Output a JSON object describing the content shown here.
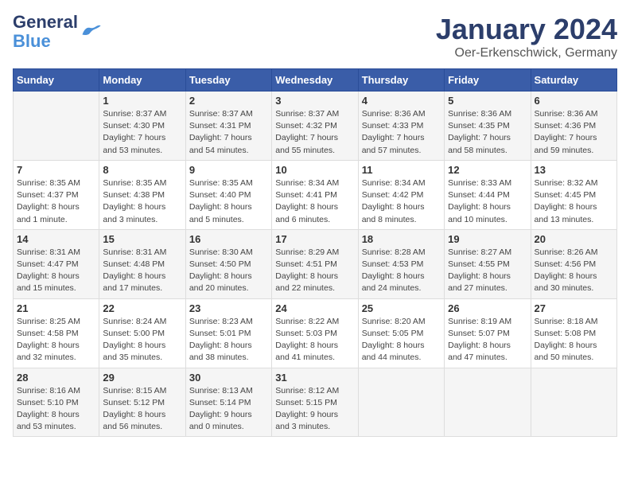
{
  "logo": {
    "line1": "General",
    "line2": "Blue"
  },
  "title": "January 2024",
  "subtitle": "Oer-Erkenschwick, Germany",
  "days_of_week": [
    "Sunday",
    "Monday",
    "Tuesday",
    "Wednesday",
    "Thursday",
    "Friday",
    "Saturday"
  ],
  "weeks": [
    [
      {
        "day": "",
        "info": ""
      },
      {
        "day": "1",
        "info": "Sunrise: 8:37 AM\nSunset: 4:30 PM\nDaylight: 7 hours\nand 53 minutes."
      },
      {
        "day": "2",
        "info": "Sunrise: 8:37 AM\nSunset: 4:31 PM\nDaylight: 7 hours\nand 54 minutes."
      },
      {
        "day": "3",
        "info": "Sunrise: 8:37 AM\nSunset: 4:32 PM\nDaylight: 7 hours\nand 55 minutes."
      },
      {
        "day": "4",
        "info": "Sunrise: 8:36 AM\nSunset: 4:33 PM\nDaylight: 7 hours\nand 57 minutes."
      },
      {
        "day": "5",
        "info": "Sunrise: 8:36 AM\nSunset: 4:35 PM\nDaylight: 7 hours\nand 58 minutes."
      },
      {
        "day": "6",
        "info": "Sunrise: 8:36 AM\nSunset: 4:36 PM\nDaylight: 7 hours\nand 59 minutes."
      }
    ],
    [
      {
        "day": "7",
        "info": "Sunrise: 8:35 AM\nSunset: 4:37 PM\nDaylight: 8 hours\nand 1 minute."
      },
      {
        "day": "8",
        "info": "Sunrise: 8:35 AM\nSunset: 4:38 PM\nDaylight: 8 hours\nand 3 minutes."
      },
      {
        "day": "9",
        "info": "Sunrise: 8:35 AM\nSunset: 4:40 PM\nDaylight: 8 hours\nand 5 minutes."
      },
      {
        "day": "10",
        "info": "Sunrise: 8:34 AM\nSunset: 4:41 PM\nDaylight: 8 hours\nand 6 minutes."
      },
      {
        "day": "11",
        "info": "Sunrise: 8:34 AM\nSunset: 4:42 PM\nDaylight: 8 hours\nand 8 minutes."
      },
      {
        "day": "12",
        "info": "Sunrise: 8:33 AM\nSunset: 4:44 PM\nDaylight: 8 hours\nand 10 minutes."
      },
      {
        "day": "13",
        "info": "Sunrise: 8:32 AM\nSunset: 4:45 PM\nDaylight: 8 hours\nand 13 minutes."
      }
    ],
    [
      {
        "day": "14",
        "info": "Sunrise: 8:31 AM\nSunset: 4:47 PM\nDaylight: 8 hours\nand 15 minutes."
      },
      {
        "day": "15",
        "info": "Sunrise: 8:31 AM\nSunset: 4:48 PM\nDaylight: 8 hours\nand 17 minutes."
      },
      {
        "day": "16",
        "info": "Sunrise: 8:30 AM\nSunset: 4:50 PM\nDaylight: 8 hours\nand 20 minutes."
      },
      {
        "day": "17",
        "info": "Sunrise: 8:29 AM\nSunset: 4:51 PM\nDaylight: 8 hours\nand 22 minutes."
      },
      {
        "day": "18",
        "info": "Sunrise: 8:28 AM\nSunset: 4:53 PM\nDaylight: 8 hours\nand 24 minutes."
      },
      {
        "day": "19",
        "info": "Sunrise: 8:27 AM\nSunset: 4:55 PM\nDaylight: 8 hours\nand 27 minutes."
      },
      {
        "day": "20",
        "info": "Sunrise: 8:26 AM\nSunset: 4:56 PM\nDaylight: 8 hours\nand 30 minutes."
      }
    ],
    [
      {
        "day": "21",
        "info": "Sunrise: 8:25 AM\nSunset: 4:58 PM\nDaylight: 8 hours\nand 32 minutes."
      },
      {
        "day": "22",
        "info": "Sunrise: 8:24 AM\nSunset: 5:00 PM\nDaylight: 8 hours\nand 35 minutes."
      },
      {
        "day": "23",
        "info": "Sunrise: 8:23 AM\nSunset: 5:01 PM\nDaylight: 8 hours\nand 38 minutes."
      },
      {
        "day": "24",
        "info": "Sunrise: 8:22 AM\nSunset: 5:03 PM\nDaylight: 8 hours\nand 41 minutes."
      },
      {
        "day": "25",
        "info": "Sunrise: 8:20 AM\nSunset: 5:05 PM\nDaylight: 8 hours\nand 44 minutes."
      },
      {
        "day": "26",
        "info": "Sunrise: 8:19 AM\nSunset: 5:07 PM\nDaylight: 8 hours\nand 47 minutes."
      },
      {
        "day": "27",
        "info": "Sunrise: 8:18 AM\nSunset: 5:08 PM\nDaylight: 8 hours\nand 50 minutes."
      }
    ],
    [
      {
        "day": "28",
        "info": "Sunrise: 8:16 AM\nSunset: 5:10 PM\nDaylight: 8 hours\nand 53 minutes."
      },
      {
        "day": "29",
        "info": "Sunrise: 8:15 AM\nSunset: 5:12 PM\nDaylight: 8 hours\nand 56 minutes."
      },
      {
        "day": "30",
        "info": "Sunrise: 8:13 AM\nSunset: 5:14 PM\nDaylight: 9 hours\nand 0 minutes."
      },
      {
        "day": "31",
        "info": "Sunrise: 8:12 AM\nSunset: 5:15 PM\nDaylight: 9 hours\nand 3 minutes."
      },
      {
        "day": "",
        "info": ""
      },
      {
        "day": "",
        "info": ""
      },
      {
        "day": "",
        "info": ""
      }
    ]
  ]
}
